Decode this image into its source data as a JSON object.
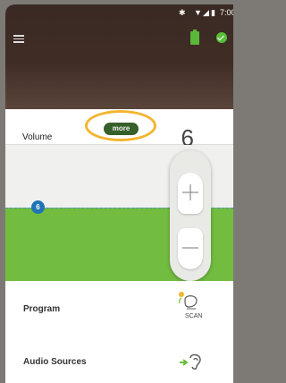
{
  "status_bar": {
    "bluetooth_icon": "bluetooth-icon",
    "wifi_icon": "wifi-icon",
    "signal_icon": "signal-icon",
    "battery_icon": "battery-icon",
    "time": "7:00"
  },
  "header": {
    "menu_icon": "menu-icon",
    "battery_status_icon": "battery-icon",
    "connected_status_icon": "check-icon",
    "accent_color": "#5bbd3c"
  },
  "volume": {
    "label": "Volume",
    "value": "6",
    "level_badge": "6",
    "level_fraction": 0.46,
    "fill_color": "#72bd40",
    "more_label": "more"
  },
  "program": {
    "label": "Program",
    "icon_label": "SCAN"
  },
  "audio_sources": {
    "label": "Audio Sources",
    "icon": "ear-sound-icon"
  }
}
